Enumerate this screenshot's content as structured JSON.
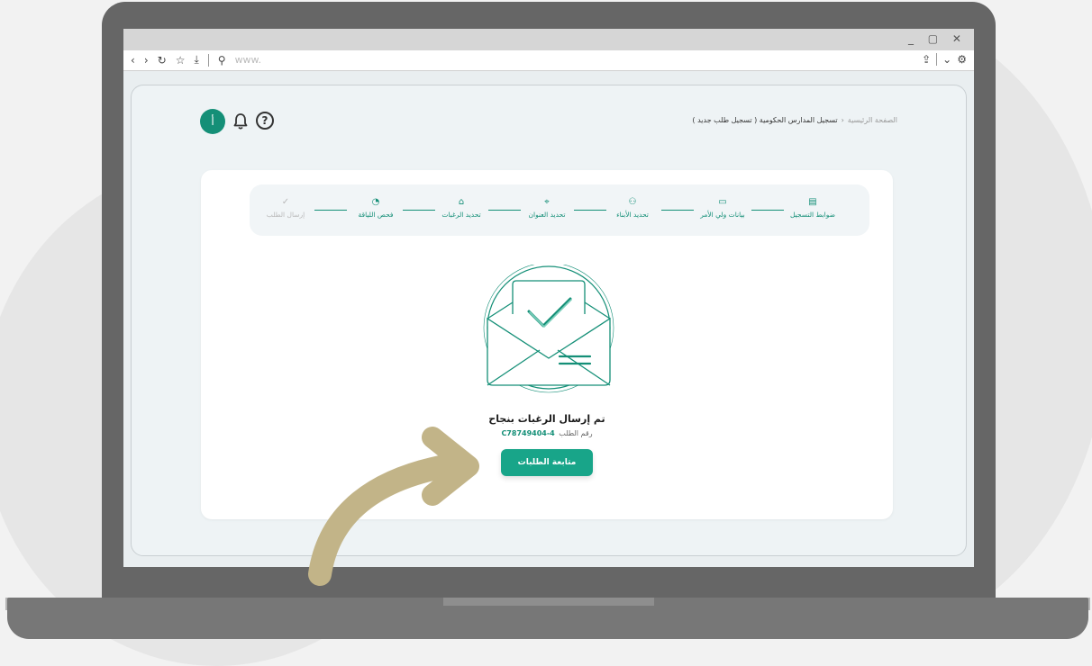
{
  "colors": {
    "brand": "#148f77",
    "button": "#18a589",
    "arrow": "#c2b488",
    "inactive": "#b9b9b9"
  },
  "browser": {
    "window_controls": "_ ▢ ✕",
    "url_placeholder": "www."
  },
  "header": {
    "avatar_letter": "أ",
    "breadcrumb": {
      "home": "الصفحة الرئيسية",
      "current": "تسجيل المدارس الحكومية ( تسجيل طلب جديد )"
    }
  },
  "stepper": {
    "steps": [
      {
        "label": "ضوابط التسجيل",
        "icon": "document-icon",
        "done": true
      },
      {
        "label": "بيانات ولي الأمر",
        "icon": "id-card-icon",
        "done": true
      },
      {
        "label": "تحديد الأبناء",
        "icon": "users-icon",
        "done": true
      },
      {
        "label": "تحديد العنوان",
        "icon": "location-icon",
        "done": true
      },
      {
        "label": "تحديد الرغبات",
        "icon": "school-icon",
        "done": true
      },
      {
        "label": "فحص اللياقة",
        "icon": "fitness-icon",
        "done": true
      },
      {
        "label": "إرسال الطلب",
        "icon": "check-icon",
        "done": false
      }
    ]
  },
  "result": {
    "title": "تم إرسال الرغبات بنجاح",
    "ref_label": "رقم الطلب",
    "ref_number": "C78749404-4",
    "button_label": "متابعة الطلبات"
  }
}
